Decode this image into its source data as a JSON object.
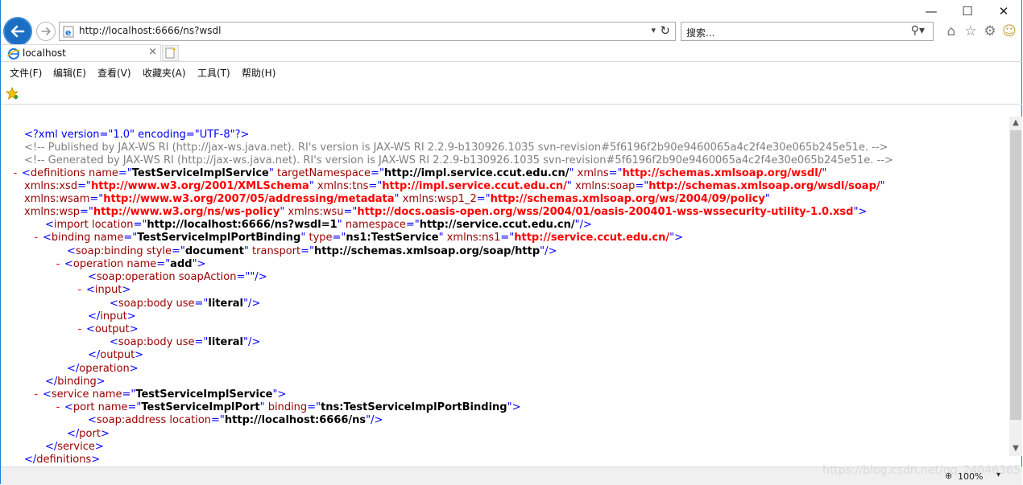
{
  "window": {
    "minimize": "—",
    "maximize": "☐",
    "close": "✕"
  },
  "nav": {
    "url": "http://localhost:6666/ns?wsdl",
    "search_placeholder": "搜索..."
  },
  "tab": {
    "title": "localhost"
  },
  "menu": {
    "file": "文件(F)",
    "edit": "编辑(E)",
    "view": "查看(V)",
    "favorites": "收藏夹(A)",
    "tools": "工具(T)",
    "help": "帮助(H)"
  },
  "xml": {
    "decl": "<?xml version=\"1.0\" encoding=\"UTF-8\"?>",
    "comment1": "<!-- Published by JAX-WS RI (http://jax-ws.java.net). RI's version is JAX-WS RI 2.2.9-b130926.1035 svn-revision#5f6196f2b90e9460065a4c2f4e30e065b245e51e. -->",
    "comment2": "<!-- Generated by JAX-WS RI (http://jax-ws.java.net). RI's version is JAX-WS RI 2.2.9-b130926.1035 svn-revision#5f6196f2b90e9460065a4c2f4e30e065b245e51e. -->",
    "def_tag": "definitions",
    "def_name_attr": "name",
    "def_name_val": "TestServiceImplService",
    "def_tns_attr": "targetNamespace",
    "def_tns_val": "http://impl.service.ccut.edu.cn/",
    "xmlns_attr": "xmlns",
    "xmlns_val": "http://schemas.xmlsoap.org/wsdl/",
    "xsd_attr": "xmlns:xsd",
    "xsd_val": "http://www.w3.org/2001/XMLSchema",
    "tns_attr": "xmlns:tns",
    "tns_val": "http://impl.service.ccut.edu.cn/",
    "soap_attr": "xmlns:soap",
    "soap_val": "http://schemas.xmlsoap.org/wsdl/soap/",
    "wsam_attr": "xmlns:wsam",
    "wsam_val": "http://www.w3.org/2007/05/addressing/metadata",
    "wsp1_attr": "xmlns:wsp1_2",
    "wsp1_val": "http://schemas.xmlsoap.org/ws/2004/09/policy",
    "wsp_attr": "xmlns:wsp",
    "wsp_val": "http://www.w3.org/ns/ws-policy",
    "wsu_attr": "xmlns:wsu",
    "wsu_val": "http://docs.oasis-open.org/wss/2004/01/oasis-200401-wss-wssecurity-utility-1.0.xsd",
    "import_loc": "http://localhost:6666/ns?wsdl=1",
    "import_ns": "http://service.ccut.edu.cn/",
    "binding_name": "TestServiceImplPortBinding",
    "binding_type": "ns1:TestService",
    "ns1_val": "http://service.ccut.edu.cn/",
    "soapbinding_style": "document",
    "soapbinding_transport": "http://schemas.xmlsoap.org/soap/http",
    "op_name": "add",
    "soapaction": "",
    "body_use": "literal",
    "service_name": "TestServiceImplService",
    "port_name": "TestServiceImplPort",
    "port_binding": "tns:TestServiceImplPortBinding",
    "address_loc": "http://localhost:6666/ns"
  },
  "status": {
    "zoom": "100%",
    "watermark": "https://blog.csdn.net/qq_24046365"
  },
  "colors": {
    "tag": "#990000",
    "bracket": "#0000ff",
    "comment": "#808080",
    "ns_value": "#ff0000"
  }
}
